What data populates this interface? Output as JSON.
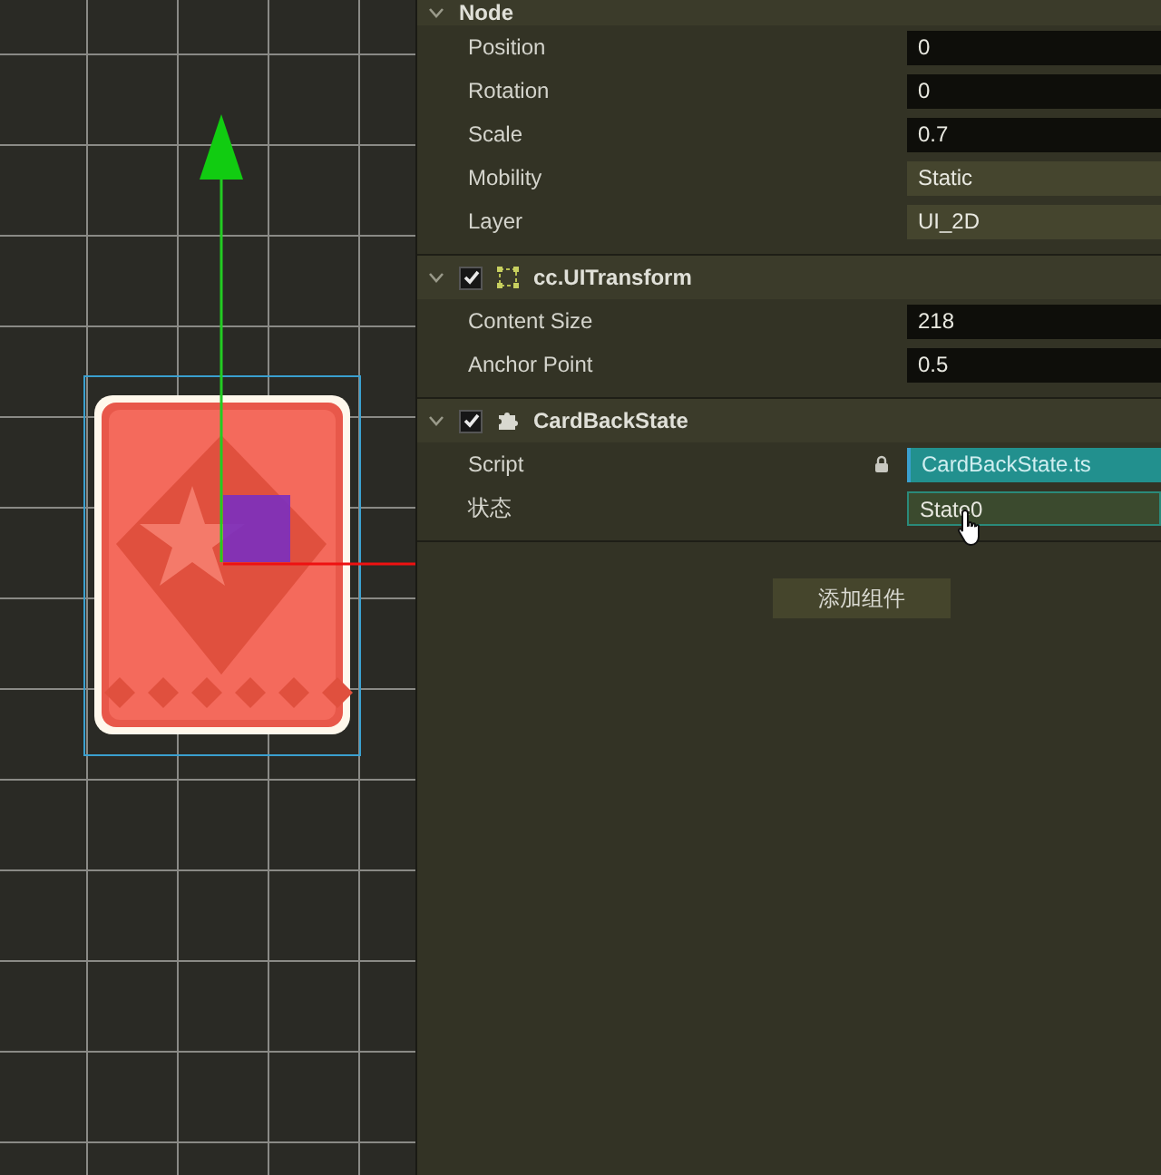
{
  "inspector": {
    "sections": [
      {
        "kind": "node",
        "title": "Node",
        "expanded": true,
        "properties": [
          {
            "label": "Position",
            "value": "0",
            "kind": "number",
            "locked": false
          },
          {
            "label": "Rotation",
            "value": "0",
            "kind": "number",
            "locked": false
          },
          {
            "label": "Scale",
            "value": "0.7",
            "kind": "number",
            "locked": false
          },
          {
            "label": "Mobility",
            "value": "Static",
            "kind": "select",
            "locked": false
          },
          {
            "label": "Layer",
            "value": "UI_2D",
            "kind": "select",
            "locked": false
          }
        ]
      },
      {
        "kind": "transform",
        "title": "cc.UITransform",
        "expanded": true,
        "enabled": true,
        "properties": [
          {
            "label": "Content Size",
            "value": "218",
            "kind": "number",
            "locked": false
          },
          {
            "label": "Anchor Point",
            "value": "0.5",
            "kind": "number",
            "locked": false
          }
        ]
      },
      {
        "kind": "script",
        "title": "CardBackState",
        "expanded": true,
        "enabled": true,
        "properties": [
          {
            "label": "Script",
            "value": "CardBackState.ts",
            "kind": "asset",
            "locked": true
          },
          {
            "label": "状态",
            "value": "State0",
            "kind": "enum",
            "locked": false
          }
        ]
      }
    ],
    "add_component_button": "添加组件"
  }
}
